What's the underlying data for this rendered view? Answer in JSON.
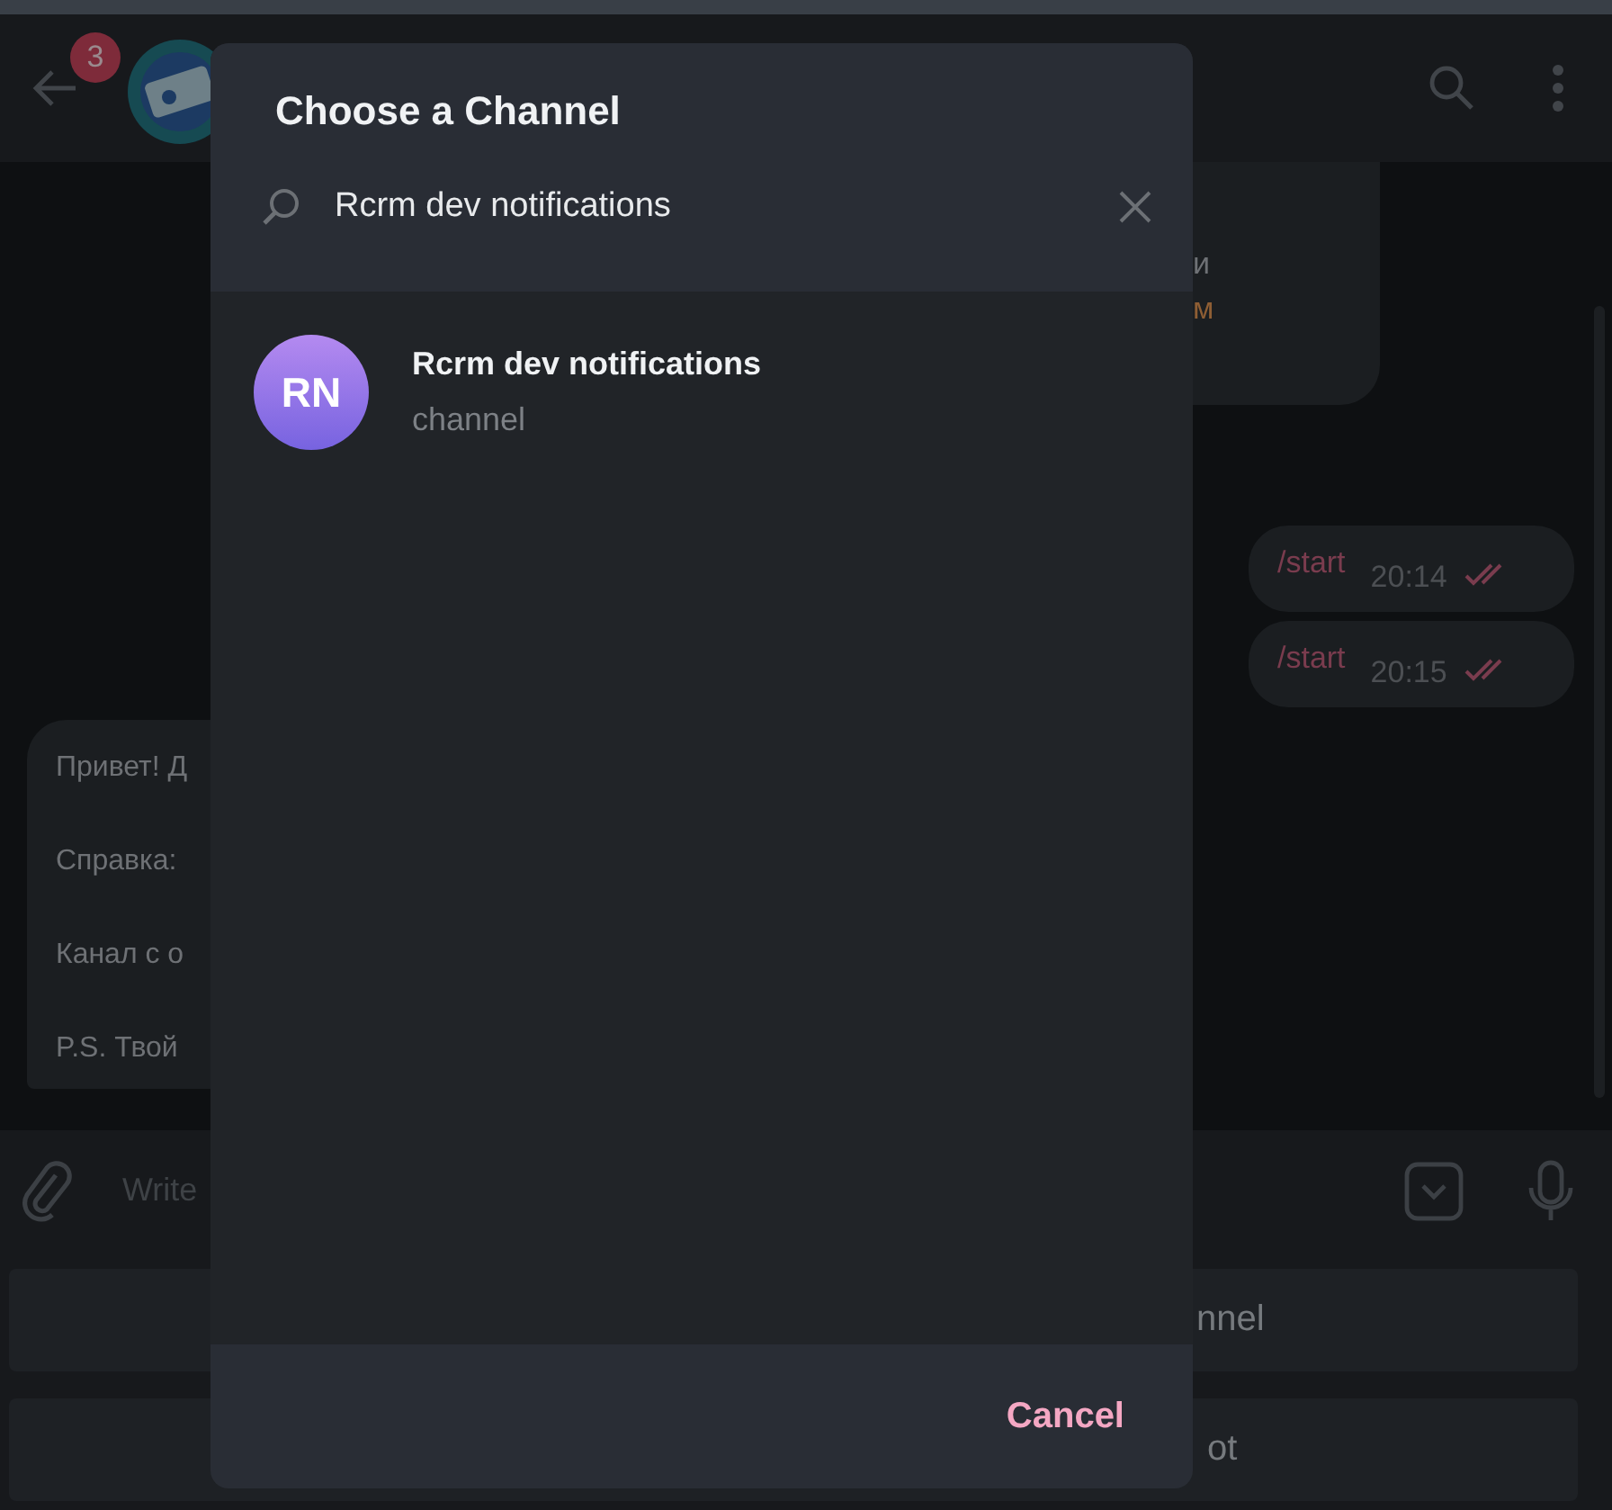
{
  "chat": {
    "header": {
      "badge": "3"
    },
    "top_bubble": {
      "lines": [
        {
          "kind": "text",
          "text": "и"
        },
        {
          "kind": "link",
          "text": "м"
        }
      ]
    },
    "outgoing": [
      {
        "text": "/start",
        "time": "20:14"
      },
      {
        "text": "/start",
        "time": "20:15"
      }
    ],
    "incoming_lines": [
      "Привет! Д",
      "Справка:",
      "Канал с о",
      "P.S. Твой"
    ],
    "composer": {
      "placeholder": "Write"
    },
    "keyboard": [
      "nnel",
      "ot"
    ]
  },
  "dialog": {
    "title": "Choose a Channel",
    "search": {
      "value": "Rcrm dev notifications"
    },
    "results": [
      {
        "initials": "RN",
        "name": "Rcrm dev notifications",
        "subtitle": "channel"
      }
    ],
    "buttons": [
      "Cancel"
    ]
  }
}
